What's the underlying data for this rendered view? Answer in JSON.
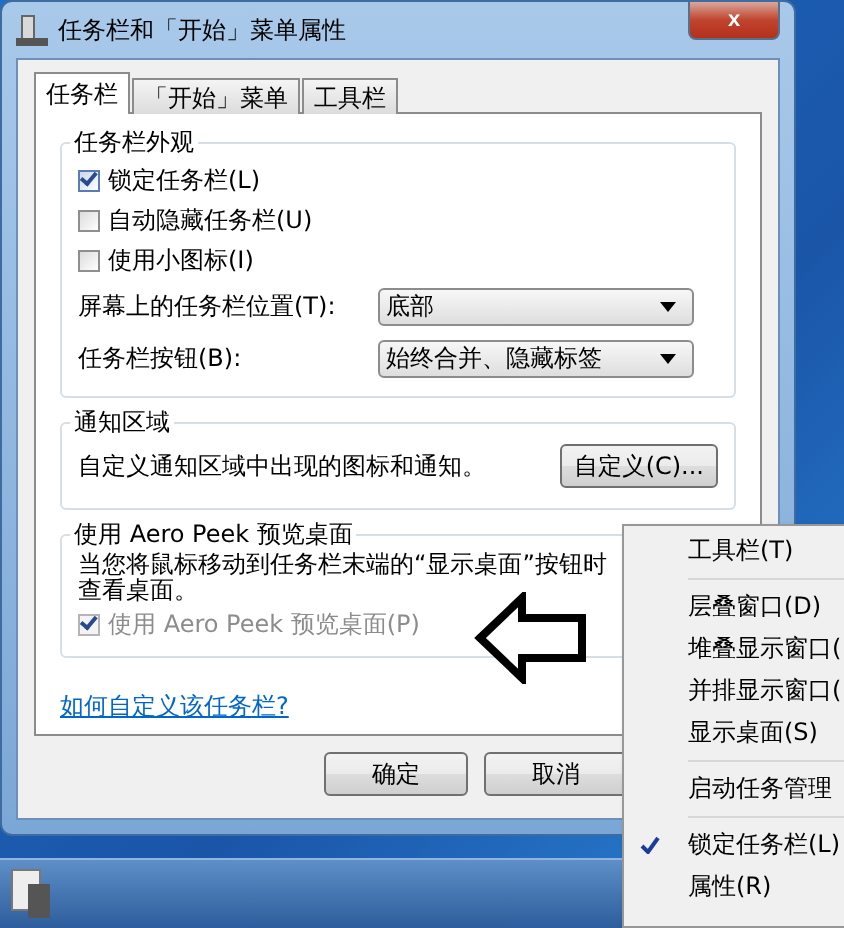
{
  "window": {
    "title": "任务栏和「开始」菜单属性",
    "close": "x"
  },
  "tabs": [
    {
      "label": "任务栏",
      "selected": true
    },
    {
      "label": "「开始」菜单",
      "selected": false
    },
    {
      "label": "工具栏",
      "selected": false
    }
  ],
  "appearance": {
    "title": "任务栏外观",
    "checkboxes": [
      {
        "label": "锁定任务栏(L)",
        "checked": true
      },
      {
        "label": "自动隐藏任务栏(U)",
        "checked": false
      },
      {
        "label": "使用小图标(I)",
        "checked": false
      }
    ],
    "dropdowns": [
      {
        "label": "屏幕上的任务栏位置(T):",
        "value": "底部"
      },
      {
        "label": "任务栏按钮(B):",
        "value": "始终合并、隐藏标签"
      }
    ]
  },
  "notification": {
    "title": "通知区域",
    "text": "自定义通知区域中出现的图标和通知。",
    "button": "自定义(C)..."
  },
  "aero_peek": {
    "title": "使用 Aero Peek 预览桌面",
    "text_lines": [
      "当您将鼠标移动到任务栏末端的“显示桌面”按钮时",
      "查看桌面。"
    ],
    "checkbox": {
      "label": "使用 Aero Peek 预览桌面(P)",
      "checked": true,
      "disabled": true
    }
  },
  "help_link": "如何自定义该任务栏?",
  "buttons": [
    "确定",
    "取消"
  ],
  "context_menu": [
    [
      {
        "label": "工具栏(T)",
        "checked": false
      }
    ],
    [
      {
        "label": "层叠窗口(D)",
        "checked": false
      },
      {
        "label": "堆叠显示窗口(",
        "checked": false
      },
      {
        "label": "并排显示窗口(",
        "checked": false
      },
      {
        "label": "显示桌面(S)",
        "checked": false
      }
    ],
    [
      {
        "label": "启动任务管理",
        "checked": false
      }
    ],
    [
      {
        "label": "锁定任务栏(L)",
        "checked": true
      },
      {
        "label": "属性(R)",
        "checked": false
      }
    ]
  ]
}
